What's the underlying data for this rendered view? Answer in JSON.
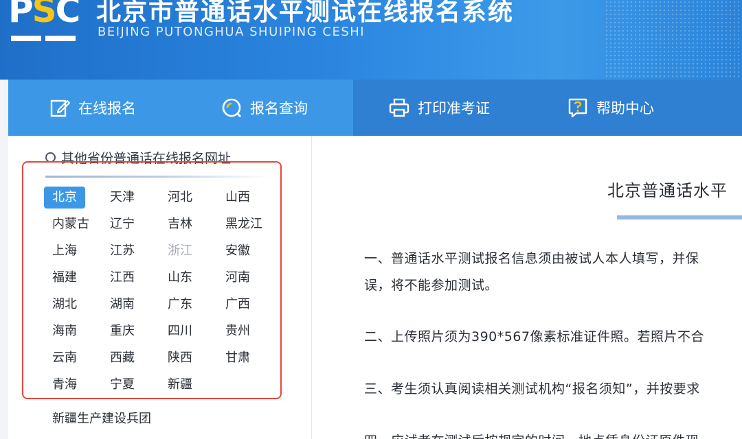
{
  "header": {
    "logo_text": "PSC",
    "title": "北京市普通话水平测试在线报名系统",
    "subtitle": "BEIJING PUTONGHUA SHUIPING CESHI"
  },
  "nav": [
    {
      "label": "在线报名",
      "icon": "edit-icon"
    },
    {
      "label": "报名查询",
      "icon": "search-icon"
    },
    {
      "label": "打印准考证",
      "icon": "printer-icon"
    },
    {
      "label": "帮助中心",
      "icon": "help-icon"
    }
  ],
  "sidebar": {
    "heading": "其他省份普通话在线报名网址",
    "provinces": [
      [
        "北京",
        "天津",
        "河北",
        "山西"
      ],
      [
        "内蒙古",
        "辽宁",
        "吉林",
        "黑龙江"
      ],
      [
        "上海",
        "江苏",
        "浙江",
        "安徽"
      ],
      [
        "福建",
        "江西",
        "山东",
        "河南"
      ],
      [
        "湖北",
        "湖南",
        "广东",
        "广西"
      ],
      [
        "海南",
        "重庆",
        "四川",
        "贵州"
      ],
      [
        "云南",
        "西藏",
        "陕西",
        "甘肃"
      ],
      [
        "青海",
        "宁夏",
        "新疆"
      ]
    ],
    "active": "北京",
    "muted": "浙江",
    "extra": "新疆生产建设兵团"
  },
  "main": {
    "title": "北京普通话水平",
    "paragraphs": [
      "一、普通话水平测试报名信息须由被试人本人填写，并保",
      "误，将不能参加测试。",
      "二、上传照片须为390*567像素标准证件照。若照片不合",
      "三、考生须认真阅读相关测试机构“报名须知”，并按要求",
      "四、应试者在测试后按规定的时间、地点凭身份证原件现"
    ]
  },
  "colors": {
    "header_blue": "#2b86e0",
    "nav_blue": "#3c98e6",
    "nav_dark": "#2f7fd2",
    "active_bg": "#3c98e6",
    "highlight_box": "#e8463b"
  }
}
